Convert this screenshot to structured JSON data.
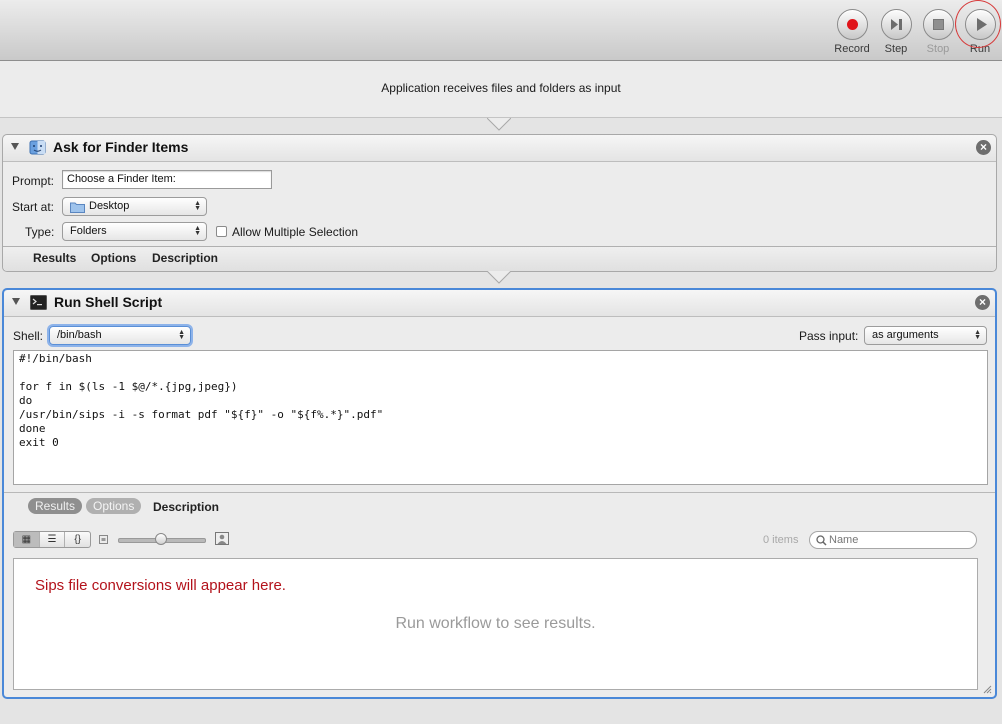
{
  "toolbar": {
    "buttons": [
      {
        "label": "Record",
        "icon": "record-icon"
      },
      {
        "label": "Step",
        "icon": "step-icon"
      },
      {
        "label": "Stop",
        "icon": "stop-icon"
      },
      {
        "label": "Run",
        "icon": "play-icon"
      }
    ]
  },
  "workflow": {
    "input_description": "Application receives files and folders as input"
  },
  "ask_action": {
    "title": "Ask for Finder Items",
    "prompt_label": "Prompt:",
    "prompt_value": "Choose a Finder Item:",
    "start_at_label": "Start at:",
    "start_at_value": "Desktop",
    "type_label": "Type:",
    "type_value": "Folders",
    "allow_multiple_label": "Allow Multiple Selection",
    "tabs": [
      "Results",
      "Options",
      "Description"
    ]
  },
  "shell_action": {
    "title": "Run Shell Script",
    "shell_label": "Shell:",
    "shell_value": "/bin/bash",
    "pass_input_label": "Pass input:",
    "pass_input_value": "as arguments",
    "script": "#!/bin/bash\n\nfor f in $(ls -1 $@/*.{jpg,jpeg})\ndo\n/usr/bin/sips -i -s format pdf \"${f}\" -o \"${f%.*}\".pdf\"\ndone\nexit 0",
    "tabs": [
      "Results",
      "Options",
      "Description"
    ],
    "view_modes": [
      "grid-view-icon",
      "list-view-icon",
      "code-view-icon"
    ],
    "item_count": "0 items",
    "search_placeholder": "Name",
    "annotation": "Sips file conversions will appear here.",
    "empty_message": "Run workflow to see results.",
    "annotation_color": "#b3121b",
    "accent_color": "#4a88d8"
  }
}
